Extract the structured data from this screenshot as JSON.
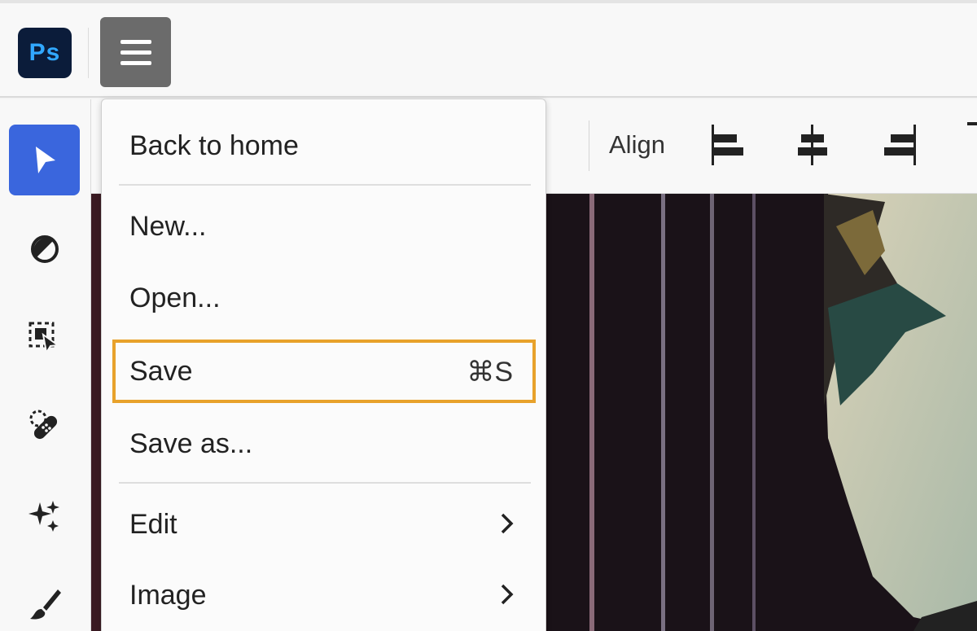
{
  "app": {
    "logo_text": "Ps",
    "logo_color": "#31a8ff",
    "logo_bg": "#0b1c3a"
  },
  "menu_button": {
    "icon": "hamburger-menu-icon"
  },
  "toolbar": {
    "tools": [
      {
        "name": "select-tool",
        "icon": "pointer-arrow-icon",
        "active": true
      },
      {
        "name": "adjustment-tool",
        "icon": "half-circle-contrast-icon",
        "active": false
      },
      {
        "name": "object-select-tool",
        "icon": "object-select-icon",
        "active": false
      },
      {
        "name": "healing-tool",
        "icon": "bandage-icon",
        "active": false
      },
      {
        "name": "generative-fill-tool",
        "icon": "sparkles-icon",
        "active": false
      },
      {
        "name": "brush-tool",
        "icon": "brush-icon",
        "active": false
      }
    ],
    "active_color": "#3a66dd"
  },
  "options_bar": {
    "align_label": "Align",
    "align_buttons": [
      "align-left-icon",
      "align-center-icon",
      "align-right-icon"
    ]
  },
  "dropdown": {
    "items": [
      {
        "label": "Back to home"
      },
      {
        "label": "New..."
      },
      {
        "label": "Open..."
      },
      {
        "label": "Save",
        "shortcut": "⌘S",
        "highlighted": true
      },
      {
        "label": "Save as..."
      },
      {
        "label": "Edit",
        "submenu": true
      },
      {
        "label": "Image",
        "submenu": true
      }
    ],
    "highlight_color": "#e8a22b"
  }
}
